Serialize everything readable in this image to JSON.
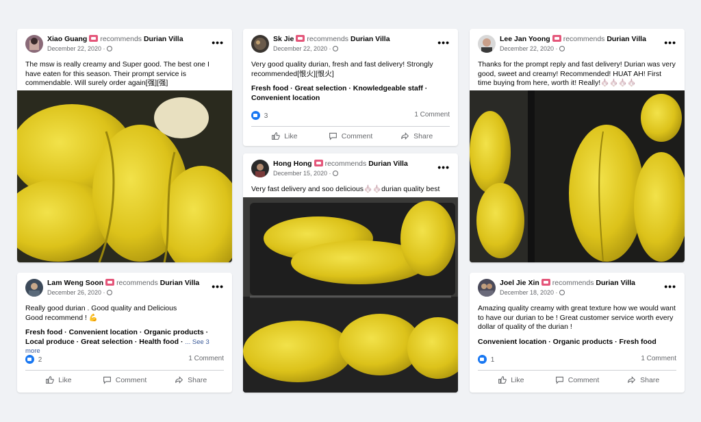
{
  "common": {
    "recommends": "recommends",
    "page_name": "Durian Villa",
    "more": "•••",
    "like": "Like",
    "comment": "Comment",
    "share": "Share"
  },
  "colors": {
    "badge": "#e4567a",
    "like": "#1877f2",
    "link": "#385898",
    "durian": "#e0c31a"
  },
  "posts": [
    {
      "author": "Xiao Guang",
      "date": "December 22, 2020 ·",
      "text": "The msw is really creamy and Super good. The best one I have eaten for this season. Their prompt service is commendable. Will surely order again[强][强]"
    },
    {
      "author": "Sk Jie",
      "date": "December 22, 2020 ·",
      "text": "Very good quality durian, fresh and fast delivery! Strongly recommended[恨火][恨火]",
      "tags": "Fresh food · Great selection · Knowledgeable staff · Convenient location",
      "likes": "3",
      "comments": "1 Comment"
    },
    {
      "author": "Lee Jan Yoong",
      "date": "December 22, 2020 ·",
      "text": "Thanks for the prompt reply and fast delivery! Durian was very good, sweet and creamy! Recommended! HUAT AH! First time buying from here, worth it! Really!🧄🧄🧄🧄"
    },
    {
      "author": "Hong Hong",
      "date": "December 15, 2020 ·",
      "text": "Very fast delivery and soo delicious🧄🧄durian quality best"
    },
    {
      "author": "Lam Weng Soon",
      "date": "December 26, 2020 ·",
      "text": "Really good durian . Good quality and Delicious",
      "text2": "Good recommend ! 💪",
      "tags": "Fresh food · Convenient location · Organic products · Local produce · Great selection · Health food ·",
      "see_more": "... See 3 more",
      "likes": "2",
      "comments": "1 Comment"
    },
    {
      "author": "Joel Jie Xin",
      "date": "December 18, 2020 ·",
      "text": "Amazing quality creamy with great texture how we would want to have our durian to be ! Great customer service worth every dollar of quality of the durian !",
      "tags": "Convenient location · Organic products · Fresh food",
      "likes": "1",
      "comments": "1 Comment"
    }
  ]
}
